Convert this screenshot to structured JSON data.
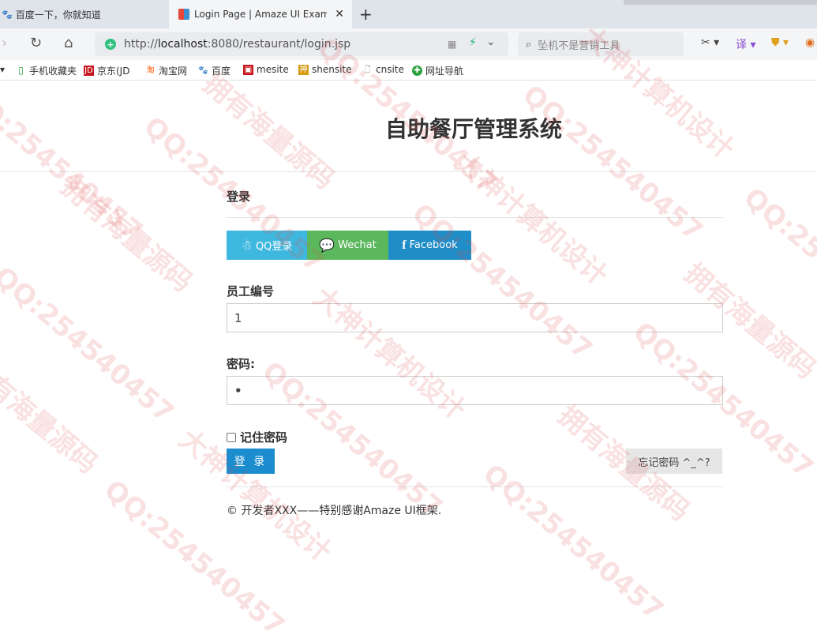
{
  "browser": {
    "tabs": [
      {
        "label": "百度一下，你就知道"
      },
      {
        "label": "Login Page | Amaze UI Example"
      }
    ],
    "address": {
      "url_prefix": "http://",
      "url_host": "localhost",
      "url_rest": ":8080/restaurant/login.jsp"
    },
    "search": {
      "placeholder": "坠机不是营销工具"
    },
    "bookmarks": [
      {
        "label": "手机收藏夹"
      },
      {
        "label": "京东(JD"
      },
      {
        "label": "淘宝网"
      },
      {
        "label": "百度"
      },
      {
        "label": "mesite"
      },
      {
        "label": "shensite"
      },
      {
        "label": "cnsite"
      },
      {
        "label": "网址导航"
      }
    ]
  },
  "page": {
    "title": "自助餐厅管理系统",
    "login_heading": "登录",
    "social": {
      "qq": "QQ登录",
      "wechat": "Wechat",
      "facebook": "Facebook"
    },
    "form": {
      "empno_label": "员工编号",
      "empno_value": "1",
      "password_label": "密码:",
      "password_value": "•",
      "remember_label": "记住密码",
      "login_button": "登 录",
      "forgot_button": "忘记密码 ^_^?"
    },
    "footer": "© 开发者XXX——特别感谢Amaze UI框架."
  },
  "watermarks": [
    "QQ:254540457",
    "拥有海量源码",
    "大神计算机设计"
  ],
  "colors": {
    "qq": "#3fb8e0",
    "wechat": "#5bb85d",
    "facebook": "#1f8dc7",
    "primary": "#1b8cce"
  }
}
